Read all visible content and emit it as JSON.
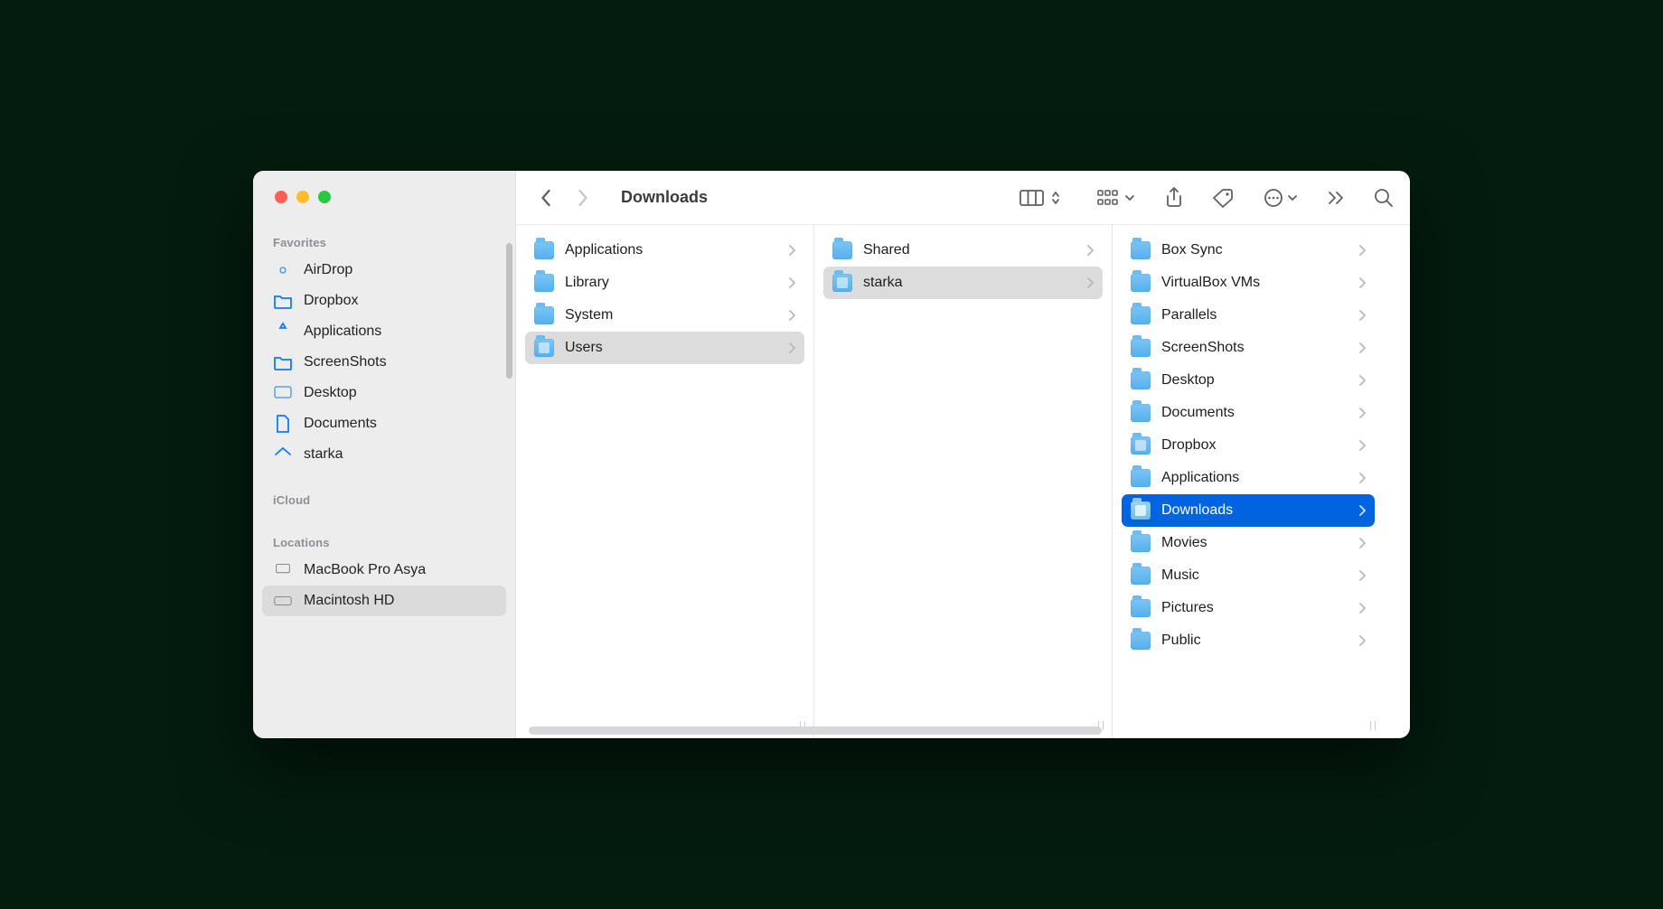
{
  "title": "Downloads",
  "sidebar": {
    "sections": [
      {
        "title": "Favorites",
        "items": [
          {
            "label": "AirDrop",
            "icon": "airdrop"
          },
          {
            "label": "Dropbox",
            "icon": "folder-outline"
          },
          {
            "label": "Applications",
            "icon": "apps"
          },
          {
            "label": "ScreenShots",
            "icon": "folder-outline"
          },
          {
            "label": "Desktop",
            "icon": "desktop"
          },
          {
            "label": "Documents",
            "icon": "document"
          },
          {
            "label": "starka",
            "icon": "home"
          }
        ]
      },
      {
        "title": "iCloud",
        "items": []
      },
      {
        "title": "Locations",
        "items": [
          {
            "label": "MacBook Pro Asya",
            "icon": "laptop",
            "dim": true
          },
          {
            "label": "Macintosh HD",
            "icon": "disk",
            "dim": true,
            "selected": true
          }
        ]
      }
    ]
  },
  "columns": [
    {
      "items": [
        {
          "label": "Applications",
          "icon": "folder"
        },
        {
          "label": "Library",
          "icon": "folder"
        },
        {
          "label": "System",
          "icon": "folder"
        },
        {
          "label": "Users",
          "icon": "folder-users",
          "pathsel": true
        }
      ]
    },
    {
      "items": [
        {
          "label": "Shared",
          "icon": "folder"
        },
        {
          "label": "starka",
          "icon": "folder-home",
          "pathsel": true
        }
      ]
    },
    {
      "items": [
        {
          "label": "Box Sync",
          "icon": "folder"
        },
        {
          "label": "VirtualBox VMs",
          "icon": "folder"
        },
        {
          "label": "Parallels",
          "icon": "folder"
        },
        {
          "label": "ScreenShots",
          "icon": "folder"
        },
        {
          "label": "Desktop",
          "icon": "folder"
        },
        {
          "label": "Documents",
          "icon": "folder"
        },
        {
          "label": "Dropbox",
          "icon": "folder-dropbox"
        },
        {
          "label": "Applications",
          "icon": "folder"
        },
        {
          "label": "Downloads",
          "icon": "folder-downloads",
          "selected": true
        },
        {
          "label": "Movies",
          "icon": "folder"
        },
        {
          "label": "Music",
          "icon": "folder"
        },
        {
          "label": "Pictures",
          "icon": "folder"
        },
        {
          "label": "Public",
          "icon": "folder"
        }
      ]
    }
  ]
}
